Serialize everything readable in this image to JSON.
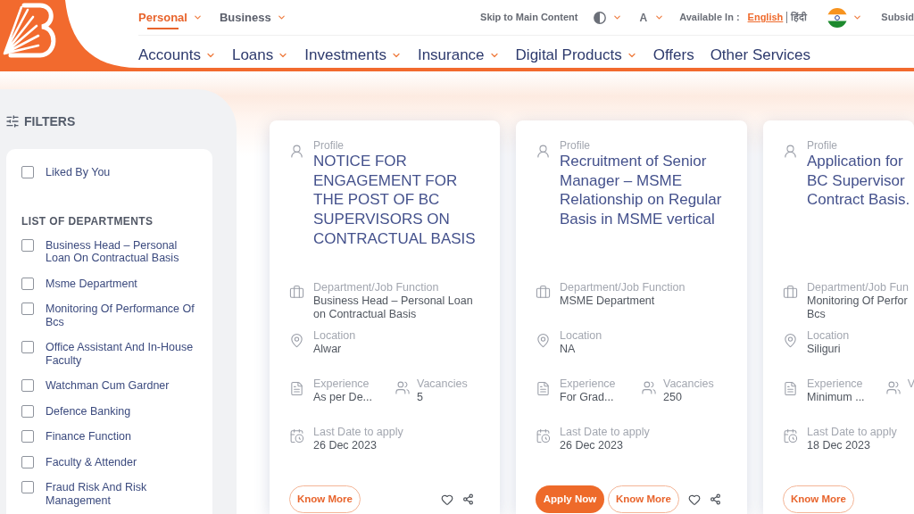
{
  "header": {
    "segments": [
      {
        "label": "Personal",
        "selected": true
      },
      {
        "label": "Business",
        "selected": false
      }
    ],
    "skip_link": "Skip to Main Content",
    "font_size_label": "A",
    "available_in": "Available In :",
    "languages": [
      {
        "label": "English",
        "selected": true
      },
      {
        "label": "हिंदी",
        "selected": false
      }
    ],
    "cut_link": "Subsid",
    "nav": [
      {
        "label": "Accounts",
        "has_menu": true
      },
      {
        "label": "Loans",
        "has_menu": true
      },
      {
        "label": "Investments",
        "has_menu": true
      },
      {
        "label": "Insurance",
        "has_menu": true
      },
      {
        "label": "Digital Products",
        "has_menu": true
      },
      {
        "label": "Offers",
        "has_menu": false
      },
      {
        "label": "Other Services",
        "has_menu": false
      }
    ]
  },
  "filters": {
    "title": "FILTERS",
    "liked": {
      "label": "Liked By You",
      "checked": false
    },
    "departments_heading": "LIST OF DEPARTMENTS",
    "departments": [
      {
        "label": "Business Head – Personal Loan On Contractual Basis",
        "checked": false
      },
      {
        "label": "Msme Department",
        "checked": false
      },
      {
        "label": "Monitoring Of Performance Of Bcs",
        "checked": false
      },
      {
        "label": "Office Assistant And In-House Faculty",
        "checked": false
      },
      {
        "label": "Watchman Cum Gardner",
        "checked": false
      },
      {
        "label": "Defence Banking",
        "checked": false
      },
      {
        "label": "Finance Function",
        "checked": false
      },
      {
        "label": "Faculty & Attender",
        "checked": false
      },
      {
        "label": "Fraud Risk And Risk Management",
        "checked": false
      }
    ]
  },
  "jobs": [
    {
      "profile_label": "Profile",
      "title": "NOTICE FOR ENGAGEMENT FOR THE POST OF BC SUPERVISORS ON CONTRACTUAL BASIS",
      "department": {
        "label": "Department/Job Function",
        "value": "Business Head – Personal Loan on Contractual Basis"
      },
      "location": {
        "label": "Location",
        "value": "Alwar"
      },
      "experience": {
        "label": "Experience",
        "value": "As per De..."
      },
      "vacancies": {
        "label": "Vacancies",
        "value": "5"
      },
      "last_date": {
        "label": "Last Date to apply",
        "value": "26 Dec 2023"
      },
      "buttons": [
        {
          "label": "Know More",
          "kind": "outline"
        }
      ],
      "liked": false
    },
    {
      "profile_label": "Profile",
      "title": "Recruitment of Senior Manager – MSME Relationship on Regular Basis in MSME vertical",
      "department": {
        "label": "Department/Job Function",
        "value": "MSME Department"
      },
      "location": {
        "label": "Location",
        "value": "NA"
      },
      "experience": {
        "label": "Experience",
        "value": "For Grad..."
      },
      "vacancies": {
        "label": "Vacancies",
        "value": "250"
      },
      "last_date": {
        "label": "Last Date to apply",
        "value": "26 Dec 2023"
      },
      "buttons": [
        {
          "label": "Apply Now",
          "kind": "primary"
        },
        {
          "label": "Know More",
          "kind": "outline"
        }
      ],
      "liked": false
    },
    {
      "profile_label": "Profile",
      "title": "Application for\nBC Supervisor\nContract Basis.",
      "department": {
        "label": "Department/Job Fun",
        "value": "Monitoring Of Perfor\nBcs"
      },
      "location": {
        "label": "Location",
        "value": "Siliguri"
      },
      "experience": {
        "label": "Experience",
        "value": "Minimum ..."
      },
      "vacancies": {
        "label": "V"
      },
      "last_date": {
        "label": "Last Date to apply",
        "value": "18 Dec 2023"
      },
      "buttons": [
        {
          "label": "Know More",
          "kind": "outline"
        }
      ]
    }
  ]
}
